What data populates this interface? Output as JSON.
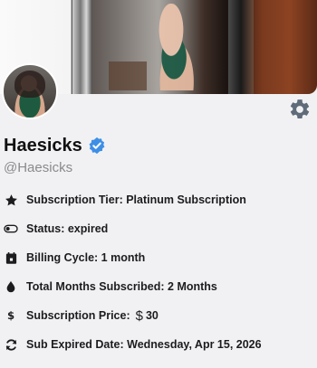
{
  "profile": {
    "name": "Haesicks",
    "handle": "@Haesicks"
  },
  "icons": {
    "settings": "gear-icon",
    "verified": "verified-badge-icon",
    "tier": "star-icon",
    "status": "toggle-icon",
    "billing": "calendar-icon",
    "months": "drop-icon",
    "price": "dollar-icon",
    "expired": "refresh-icon"
  },
  "colors": {
    "verified": "#3d8fe6",
    "settings": "#5f6b78"
  },
  "details": {
    "tier": "Subscription Tier: Platinum Subscription",
    "status": "Status: expired",
    "billing": "Billing Cycle: 1 month",
    "months": "Total Months Subscribed: 2 Months",
    "price_label": "Subscription Price:",
    "price_currency": "$",
    "price_value": "30",
    "expired": "Sub Expired Date: Wednesday, Apr 15, 2026"
  }
}
